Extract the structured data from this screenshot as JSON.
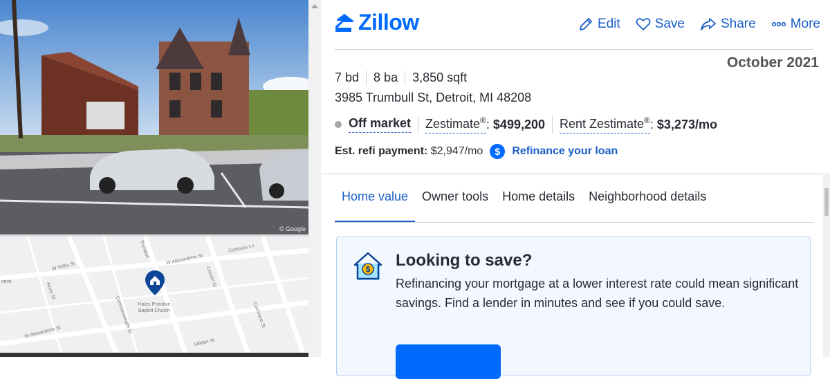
{
  "listing": {
    "photo_credit": "© Google",
    "map_labels": {
      "street1": "W Willis St",
      "street2": "W Alexandrine St",
      "street3": "Trumbull",
      "street4": "Commonwealth St",
      "street5": "Avery St",
      "street6": "Lincoln St",
      "street7": "Selden St",
      "street8": "Cochrane St",
      "street9": "Contours Ln",
      "church": "Hales Primitive Baptist Church",
      "left": "ntive"
    }
  },
  "header": {
    "brand": "Zillow",
    "actions": [
      {
        "label": "Edit",
        "icon": "pencil-icon"
      },
      {
        "label": "Save",
        "icon": "heart-icon"
      },
      {
        "label": "Share",
        "icon": "share-icon"
      },
      {
        "label": "More",
        "icon": "more-icon"
      }
    ]
  },
  "annotation": {
    "date": "October 2021"
  },
  "property": {
    "beds": "7 bd",
    "baths": "8 ba",
    "sqft": "3,850 sqft",
    "address": "3985 Trumbull St, Detroit, MI 48208",
    "status": "Off market",
    "zestimate_label": "Zestimate",
    "zestimate_reg": "®",
    "zestimate_value": "$499,200",
    "rent_label": "Rent Zestimate",
    "rent_reg": "®",
    "rent_value": "$3,273/mo",
    "refi_label": "Est. refi payment:",
    "refi_value": "$2,947/mo",
    "refi_icon": "$",
    "refi_link": "Refinance your loan"
  },
  "tabs": [
    "Home value",
    "Owner tools",
    "Home details",
    "Neighborhood details"
  ],
  "card": {
    "title": "Looking to save?",
    "body": "Refinancing your mortgage at a lower interest rate could mean significant savings. Find a lender in minutes and see if you could save."
  },
  "colors": {
    "accent": "#006aff",
    "link": "#1a5ec9"
  }
}
